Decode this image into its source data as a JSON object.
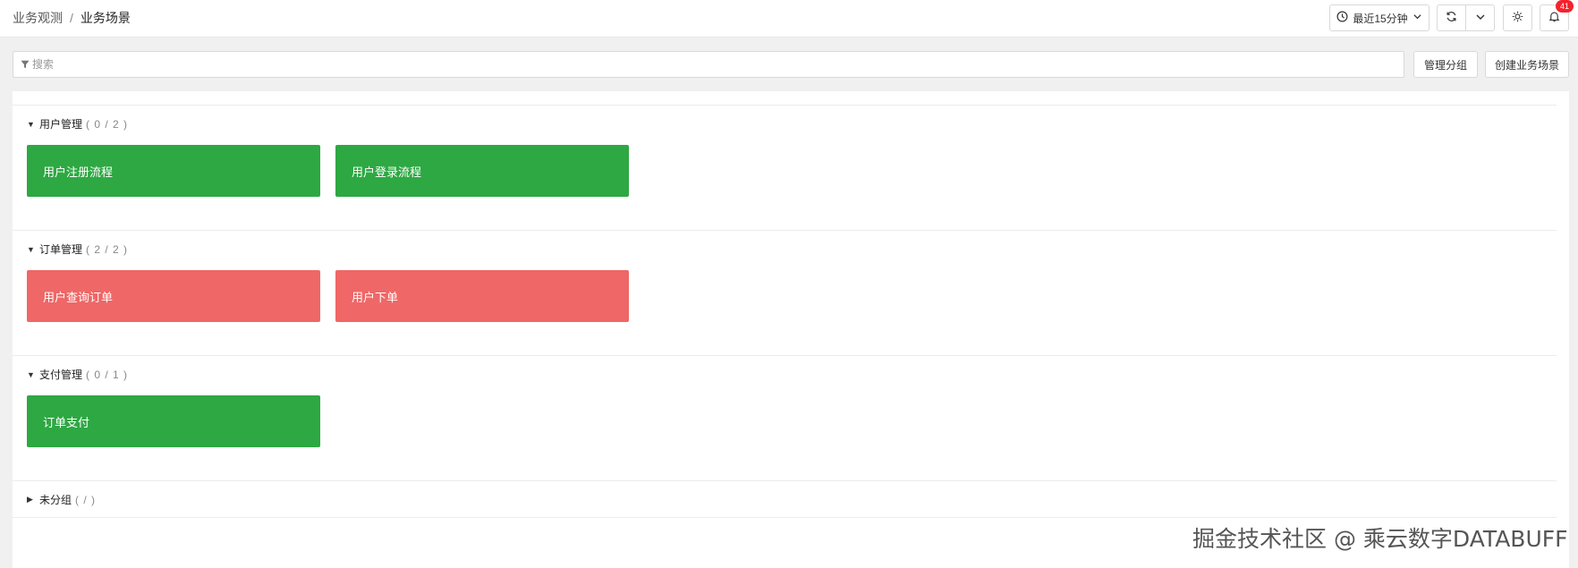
{
  "breadcrumb": {
    "parent": "业务观测",
    "separator": "/",
    "current": "业务场景"
  },
  "toolbar": {
    "time_range": "最近15分钟",
    "clock_icon": "clock-icon",
    "refresh_icon": "refresh-icon",
    "dropdown_icon": "chevron-down-icon",
    "theme_icon": "sun-icon",
    "bell_icon": "bell-icon",
    "notification_count": "41"
  },
  "search": {
    "placeholder": "搜索",
    "value": "",
    "filter_icon": "filter-icon"
  },
  "actions": {
    "manage_groups": "管理分组",
    "create_scene": "创建业务场景"
  },
  "colors": {
    "healthy": "#2ea843",
    "unhealthy": "#ef6767"
  },
  "groups": [
    {
      "name": "用户管理",
      "count": "( 0 / 2 )",
      "expanded": true,
      "cards": [
        {
          "label": "用户注册流程",
          "status": "healthy"
        },
        {
          "label": "用户登录流程",
          "status": "healthy"
        }
      ]
    },
    {
      "name": "订单管理",
      "count": "( 2 / 2 )",
      "expanded": true,
      "cards": [
        {
          "label": "用户查询订单",
          "status": "unhealthy"
        },
        {
          "label": "用户下单",
          "status": "unhealthy"
        }
      ]
    },
    {
      "name": "支付管理",
      "count": "( 0 / 1 )",
      "expanded": true,
      "cards": [
        {
          "label": "订单支付",
          "status": "healthy"
        }
      ]
    },
    {
      "name": "未分组",
      "count": "( / )",
      "expanded": false,
      "cards": []
    }
  ],
  "watermark": "掘金技术社区 @ 乘云数字DATABUFF"
}
